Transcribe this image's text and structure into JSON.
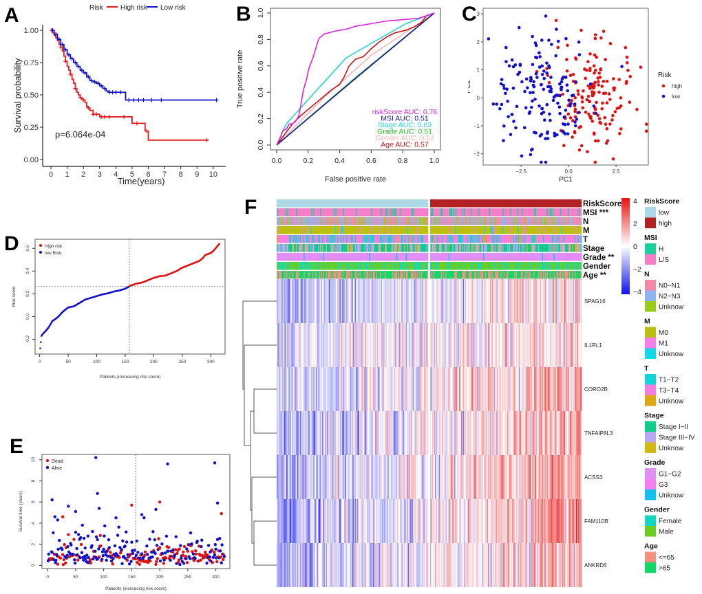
{
  "figure": {
    "panel_letters": [
      "A",
      "B",
      "C",
      "D",
      "E",
      "F"
    ]
  },
  "chart_data": [
    {
      "id": "A",
      "type": "line",
      "subtype": "kaplan-meier",
      "title": "",
      "xlabel": "Time(years)",
      "ylabel": "Survival probability",
      "xlim": [
        0,
        10.3
      ],
      "ylim": [
        0,
        1.0
      ],
      "xticks": [
        0,
        1,
        2,
        3,
        4,
        5,
        6,
        7,
        8,
        9,
        10
      ],
      "yticks": [
        0.0,
        0.25,
        0.5,
        0.75,
        1.0
      ],
      "ytick_labels": [
        "0.00",
        "0.25",
        "0.50",
        "0.75",
        "1.00"
      ],
      "legend": {
        "title": "Risk",
        "position": "top",
        "entries": [
          "High risk",
          "Low risk"
        ]
      },
      "annotation": "p=6.064e-04",
      "grid": false,
      "series": [
        {
          "name": "High risk",
          "color": "#e41a1c",
          "x": [
            0,
            0.1,
            0.2,
            0.3,
            0.4,
            0.5,
            0.6,
            0.7,
            0.8,
            0.9,
            1.0,
            1.1,
            1.2,
            1.3,
            1.4,
            1.5,
            1.6,
            1.7,
            1.8,
            1.9,
            2.0,
            2.1,
            2.2,
            2.3,
            2.4,
            2.6,
            2.8,
            3.0,
            3.2,
            4.5,
            5.0,
            5.3,
            5.8,
            6.0,
            9.7
          ],
          "y": [
            1.0,
            0.98,
            0.96,
            0.94,
            0.92,
            0.89,
            0.87,
            0.84,
            0.8,
            0.76,
            0.72,
            0.69,
            0.66,
            0.62,
            0.59,
            0.55,
            0.52,
            0.5,
            0.48,
            0.47,
            0.46,
            0.44,
            0.41,
            0.4,
            0.38,
            0.35,
            0.35,
            0.33,
            0.33,
            0.33,
            0.28,
            0.28,
            0.22,
            0.15,
            0.15
          ],
          "censor_x": [
            0.05,
            0.6,
            0.9,
            1.2,
            1.5,
            1.8,
            2.0,
            2.3,
            2.6,
            2.8,
            3.1,
            3.3,
            3.6,
            4.5,
            5.3,
            5.9,
            9.6
          ]
        },
        {
          "name": "Low risk",
          "color": "#1010cc",
          "x": [
            0,
            0.2,
            0.4,
            0.6,
            0.8,
            1.0,
            1.2,
            1.4,
            1.6,
            1.8,
            2.0,
            2.2,
            2.4,
            2.6,
            2.8,
            3.0,
            3.2,
            3.4,
            3.6,
            4.0,
            4.6,
            4.7,
            10.2
          ],
          "y": [
            1.0,
            0.97,
            0.93,
            0.89,
            0.85,
            0.81,
            0.78,
            0.75,
            0.72,
            0.69,
            0.67,
            0.64,
            0.61,
            0.6,
            0.59,
            0.57,
            0.55,
            0.53,
            0.52,
            0.52,
            0.46,
            0.46,
            0.46
          ],
          "censor_x": [
            0.1,
            0.3,
            0.5,
            0.7,
            0.9,
            1.1,
            1.3,
            1.5,
            1.7,
            1.9,
            2.1,
            2.3,
            2.5,
            2.7,
            2.9,
            3.1,
            3.3,
            3.6,
            3.8,
            4.0,
            4.3,
            4.8,
            5.1,
            5.4,
            5.7,
            6.2,
            6.8,
            10.2
          ]
        }
      ]
    },
    {
      "id": "B",
      "type": "line",
      "subtype": "roc",
      "xlabel": "False positive rate",
      "ylabel": "True positive rate",
      "xlim": [
        0,
        1
      ],
      "ylim": [
        0,
        1
      ],
      "xticks": [
        0.0,
        0.2,
        0.4,
        0.6,
        0.8,
        1.0
      ],
      "yticks": [
        0.0,
        0.2,
        0.4,
        0.6,
        0.8,
        1.0
      ],
      "grid": false,
      "legend": {
        "position": "bottom-right"
      },
      "series": [
        {
          "name": "riskScore",
          "label": "riskScore AUC: 0.76",
          "auc": 0.76,
          "color": "#dd22dd",
          "x": [
            0,
            0.02,
            0.04,
            0.06,
            0.08,
            0.1,
            0.12,
            0.14,
            0.15,
            0.16,
            0.17,
            0.18,
            0.19,
            0.2,
            0.21,
            0.22,
            0.23,
            0.24,
            0.25,
            0.26,
            0.27,
            0.28,
            0.3,
            0.33,
            0.36,
            0.4,
            0.45,
            0.5,
            0.6,
            0.7,
            0.8,
            0.9,
            0.95,
            1.0
          ],
          "y": [
            0,
            0.05,
            0.11,
            0.12,
            0.16,
            0.16,
            0.18,
            0.22,
            0.28,
            0.35,
            0.42,
            0.46,
            0.5,
            0.56,
            0.6,
            0.63,
            0.66,
            0.7,
            0.74,
            0.78,
            0.81,
            0.82,
            0.84,
            0.85,
            0.86,
            0.87,
            0.88,
            0.9,
            0.92,
            0.94,
            0.95,
            0.96,
            0.98,
            1.0
          ]
        },
        {
          "name": "MSI",
          "label": "MSI AUC: 0.51",
          "auc": 0.51,
          "color": "#1a1a9a",
          "x": [
            0,
            0.5,
            1.0
          ],
          "y": [
            0,
            0.505,
            1.0
          ]
        },
        {
          "name": "Stage",
          "label": "Stage AUC: 0.63",
          "auc": 0.63,
          "color": "#22d4d4",
          "x": [
            0,
            0.06,
            0.44,
            0.6,
            0.82,
            1.0
          ],
          "y": [
            0,
            0.16,
            0.66,
            0.77,
            0.92,
            1.0
          ]
        },
        {
          "name": "Grade",
          "label": "Grade AUC: 0.51",
          "auc": 0.51,
          "color": "#22bb22",
          "x": [
            0,
            0.5,
            1.0
          ],
          "y": [
            0,
            0.51,
            1.0
          ]
        },
        {
          "name": "Gender",
          "label": "Gender AUC: 0.54",
          "auc": 0.54,
          "color": "#f4b6b6",
          "x": [
            0,
            0.3,
            0.6,
            1.0
          ],
          "y": [
            0,
            0.36,
            0.68,
            1.0
          ]
        },
        {
          "name": "Age",
          "label": "Age AUC: 0.57",
          "auc": 0.57,
          "color": "#cc1111",
          "x": [
            0,
            0.05,
            0.1,
            0.15,
            0.2,
            0.25,
            0.3,
            0.35,
            0.4,
            0.43,
            0.46,
            0.5,
            0.55,
            0.6,
            0.65,
            0.7,
            0.75,
            0.82,
            0.88,
            0.92,
            0.95,
            1.0
          ],
          "y": [
            0,
            0.08,
            0.16,
            0.22,
            0.27,
            0.32,
            0.37,
            0.42,
            0.46,
            0.52,
            0.6,
            0.65,
            0.67,
            0.73,
            0.78,
            0.82,
            0.85,
            0.87,
            0.9,
            0.93,
            0.98,
            1.0
          ]
        }
      ]
    },
    {
      "id": "C",
      "type": "scatter",
      "subtype": "pca",
      "xlabel": "PC1",
      "ylabel": "PC2",
      "xlim": [
        -4.5,
        4.2
      ],
      "ylim": [
        -2.4,
        3.2
      ],
      "xticks": [
        -2.5,
        0.0,
        2.5
      ],
      "yticks": [
        -2,
        -1,
        0,
        1,
        2,
        3
      ],
      "grid": false,
      "legend": {
        "title": "Risk",
        "position": "right",
        "entries": [
          "high",
          "low"
        ]
      },
      "series": [
        {
          "name": "high",
          "color": "#e01010",
          "n_points": 157,
          "center": [
            1.3,
            0.0
          ],
          "spread": [
            1.1,
            0.9
          ]
        },
        {
          "name": "low",
          "color": "#1010cc",
          "n_points": 157,
          "center": [
            -1.5,
            0.1
          ],
          "spread": [
            1.3,
            1.1
          ]
        }
      ]
    },
    {
      "id": "D",
      "type": "scatter",
      "subtype": "risk-curve",
      "xlabel": "Patients (increasing risk socre)",
      "ylabel": "Risk score",
      "xlim": [
        0,
        318
      ],
      "ylim": [
        -0.3,
        0.65
      ],
      "xticks": [
        0,
        50,
        100,
        150,
        200,
        250,
        300
      ],
      "yticks": [
        -0.2,
        0.0,
        0.2,
        0.4,
        0.6
      ],
      "cutoff_x": 157,
      "cutoff_y": 0.265,
      "grid": false,
      "legend": {
        "position": "top-left",
        "entries": [
          "High risk",
          "low Risk"
        ]
      },
      "series": [
        {
          "name": "High risk",
          "color": "#e01010",
          "x": [
            158,
            170,
            180,
            190,
            200,
            210,
            220,
            230,
            240,
            250,
            260,
            270,
            280,
            285,
            290,
            300,
            305,
            310,
            315
          ],
          "y": [
            0.27,
            0.29,
            0.3,
            0.32,
            0.34,
            0.355,
            0.36,
            0.38,
            0.4,
            0.43,
            0.45,
            0.47,
            0.49,
            0.51,
            0.54,
            0.56,
            0.58,
            0.61,
            0.64
          ]
        },
        {
          "name": "low Risk",
          "color": "#1010cc",
          "x": [
            1,
            3,
            6,
            10,
            15,
            20,
            22,
            28,
            33,
            40,
            45,
            50,
            55,
            60,
            70,
            80,
            90,
            100,
            110,
            120,
            130,
            140,
            150,
            157
          ],
          "y": [
            -0.28,
            -0.17,
            -0.15,
            -0.13,
            -0.1,
            -0.06,
            -0.04,
            -0.02,
            0.0,
            0.04,
            0.06,
            0.08,
            0.085,
            0.09,
            0.12,
            0.15,
            0.165,
            0.18,
            0.195,
            0.205,
            0.22,
            0.23,
            0.245,
            0.265
          ]
        }
      ]
    },
    {
      "id": "E",
      "type": "scatter",
      "subtype": "survival-status",
      "xlabel": "Patients (increasing risk socre)",
      "ylabel": "Survival time (years)",
      "xlim": [
        -10,
        325
      ],
      "ylim": [
        -0.3,
        10.5
      ],
      "xticks": [
        0,
        50,
        100,
        150,
        200,
        250,
        300
      ],
      "yticks": [
        0,
        2,
        4,
        6,
        8,
        10
      ],
      "cutoff_x": 157,
      "grid": false,
      "legend": {
        "position": "top-left",
        "entries": [
          "Dead",
          "Alive"
        ]
      },
      "highlight_points": [
        {
          "status": "Alive",
          "x": 86,
          "y": 10.2
        },
        {
          "status": "Alive",
          "x": 214,
          "y": 9.6
        },
        {
          "status": "Alive",
          "x": 298,
          "y": 9.7
        },
        {
          "status": "Alive",
          "x": 89,
          "y": 6.8
        },
        {
          "status": "Alive",
          "x": 8,
          "y": 6.2
        },
        {
          "status": "Dead",
          "x": 200,
          "y": 6.0
        },
        {
          "status": "Alive",
          "x": 303,
          "y": 5.9
        },
        {
          "status": "Dead",
          "x": 150,
          "y": 5.7
        },
        {
          "status": "Alive",
          "x": 37,
          "y": 5.6
        },
        {
          "status": "Alive",
          "x": 92,
          "y": 5.4
        },
        {
          "status": "Alive",
          "x": 193,
          "y": 5.3
        },
        {
          "status": "Alive",
          "x": 50,
          "y": 5.1
        },
        {
          "status": "Dead",
          "x": 310,
          "y": 4.9
        },
        {
          "status": "Alive",
          "x": 168,
          "y": 4.8
        },
        {
          "status": "Alive",
          "x": 13,
          "y": 4.6
        },
        {
          "status": "Dead",
          "x": 27,
          "y": 4.6
        },
        {
          "status": "Alive",
          "x": 122,
          "y": 4.5
        },
        {
          "status": "Alive",
          "x": 172,
          "y": 4.5
        },
        {
          "status": "Alive",
          "x": 18,
          "y": 4.3
        }
      ],
      "series": [
        {
          "name": "Dead",
          "color": "#e01010",
          "n_points": 140
        },
        {
          "name": "Alive",
          "color": "#1010cc",
          "n_points": 175
        }
      ]
    },
    {
      "id": "F",
      "type": "heatmap",
      "row_labels": [
        "SPAG16",
        "IL1RL1",
        "CORO2B",
        "TNFAIP8L3",
        "ACSS3",
        "FAM110B",
        "ANKRD6"
      ],
      "n_columns": 314,
      "split_at_column": 157,
      "row_gradient": [
        {
          "gene": "SPAG16",
          "low_mean": -1.2,
          "high_mean": 0.8
        },
        {
          "gene": "IL1RL1",
          "low_mean": -0.6,
          "high_mean": 0.5
        },
        {
          "gene": "CORO2B",
          "low_mean": -0.8,
          "high_mean": 1.1
        },
        {
          "gene": "TNFAIP8L3",
          "low_mean": -0.9,
          "high_mean": 1.0
        },
        {
          "gene": "ACSS3",
          "low_mean": -1.1,
          "high_mean": 1.2
        },
        {
          "gene": "FAM110B",
          "low_mean": -1.2,
          "high_mean": 1.3
        },
        {
          "gene": "ANKRD6",
          "low_mean": -1.2,
          "high_mean": 1.1
        }
      ],
      "color_scale": {
        "min": -4,
        "max": 4,
        "ticks": [
          4,
          2,
          0,
          -2,
          -4
        ],
        "tick_labels": [
          "4",
          "2",
          "0",
          "−2",
          "−4"
        ],
        "low_color": "#1010ee",
        "mid_color": "#ffffff",
        "high_color": "#ee1010"
      },
      "annotation_tracks": [
        {
          "name": "RiskScore",
          "label": "RiskScore",
          "sig": ""
        },
        {
          "name": "MSI",
          "label": "MSI",
          "sig": "***"
        },
        {
          "name": "N",
          "label": "N",
          "sig": ""
        },
        {
          "name": "M",
          "label": "M",
          "sig": ""
        },
        {
          "name": "T",
          "label": "T",
          "sig": ""
        },
        {
          "name": "Stage",
          "label": "Stage",
          "sig": ""
        },
        {
          "name": "Grade",
          "label": "Grade",
          "sig": "**"
        },
        {
          "name": "Gender",
          "label": "Gender",
          "sig": ""
        },
        {
          "name": "Age",
          "label": "Age",
          "sig": "**"
        }
      ],
      "legends": [
        {
          "title": "RiskScore",
          "items": [
            {
              "label": "low",
              "color": "#add8e6"
            },
            {
              "label": "high",
              "color": "#b22222"
            }
          ]
        },
        {
          "title": "MSI",
          "items": [
            {
              "label": "H",
              "color": "#1ccf9a"
            },
            {
              "label": "L/S",
              "color": "#f47fc8"
            }
          ]
        },
        {
          "title": "N",
          "items": [
            {
              "label": "N0−N1",
              "color": "#f48aa8"
            },
            {
              "label": "N2−N3",
              "color": "#8fb4f4"
            },
            {
              "label": "Unknow",
              "color": "#9acd1a"
            }
          ]
        },
        {
          "title": "M",
          "items": [
            {
              "label": "M0",
              "color": "#bcbf10"
            },
            {
              "label": "M1",
              "color": "#f47fe8"
            },
            {
              "label": "Unknow",
              "color": "#10d8e8"
            }
          ]
        },
        {
          "title": "T",
          "items": [
            {
              "label": "T1−T2",
              "color": "#10d4d8"
            },
            {
              "label": "T3−T4",
              "color": "#f47fe0"
            },
            {
              "label": "Unknow",
              "color": "#e0a810"
            }
          ]
        },
        {
          "title": "Stage",
          "items": [
            {
              "label": "Stage I−II",
              "color": "#10cc88"
            },
            {
              "label": "Stage III−IV",
              "color": "#b8a8f4"
            },
            {
              "label": "Unknow",
              "color": "#d4b810"
            }
          ]
        },
        {
          "title": "Grade",
          "items": [
            {
              "label": "G1−G2",
              "color": "#e090f4"
            },
            {
              "label": "G3",
              "color": "#f47ff4"
            },
            {
              "label": "Unknow",
              "color": "#10c0f0"
            }
          ]
        },
        {
          "title": "Gender",
          "items": [
            {
              "label": "Female",
              "color": "#10d8c0"
            },
            {
              "label": "Male",
              "color": "#6ccc20"
            }
          ]
        },
        {
          "title": "Age",
          "items": [
            {
              "label": "<=65",
              "color": "#f49080"
            },
            {
              "label": ">65",
              "color": "#10d868"
            }
          ]
        }
      ]
    }
  ]
}
